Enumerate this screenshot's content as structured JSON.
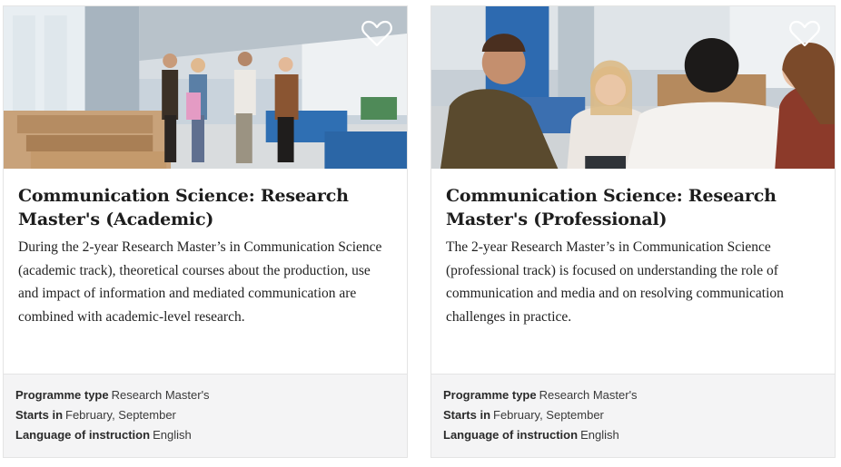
{
  "cards": [
    {
      "title": "Communication Science: Research Master's (Academic)",
      "description": "During the 2-year Research Master’s in Communication Science (academic track), theoretical courses about the production, use and impact of information and mediated communication are combined with academic-level research.",
      "meta": [
        {
          "label": "Programme type",
          "value": "Research Master's"
        },
        {
          "label": "Starts in",
          "value": "February, September"
        },
        {
          "label": "Language of instruction",
          "value": "English"
        }
      ]
    },
    {
      "title": "Communication Science: Research Master's (Professional)",
      "description": "The 2-year Research Master’s in Communication Science (professional track) is focused on understanding the role of communication and media and on resolving communication challenges in practice.",
      "meta": [
        {
          "label": "Programme type",
          "value": "Research Master's"
        },
        {
          "label": "Starts in",
          "value": "February, September"
        },
        {
          "label": "Language of instruction",
          "value": "English"
        }
      ]
    }
  ],
  "icons": {
    "favorite": "heart-outline-icon"
  },
  "colors": {
    "meta_background": "#f4f4f5",
    "border": "#e4e4e4"
  }
}
